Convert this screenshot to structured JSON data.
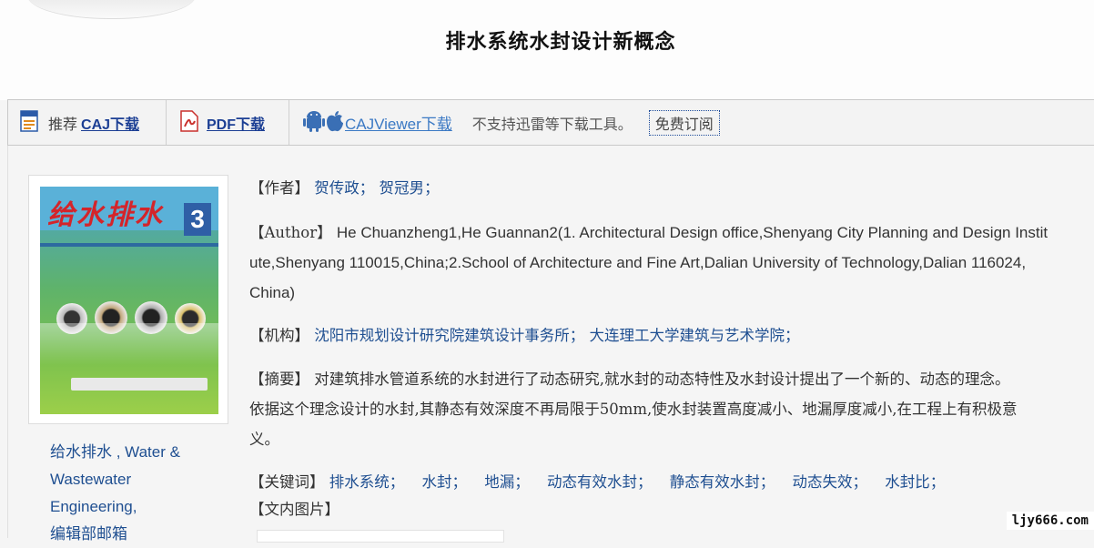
{
  "page": {
    "title": "排水系统水封设计新概念"
  },
  "toolbar": {
    "recommend_label": "推荐",
    "caj_download_label": "CAJ下载",
    "pdf_download_label": "PDF下载",
    "cajviewer_label": "CAJViewer下载",
    "note": "不支持迅雷等下载工具。",
    "subscribe_label": "免费订阅"
  },
  "journal": {
    "cover_title": "给水排水",
    "cover_issue": "3",
    "name_line1": "给水排水 , Water &",
    "name_line2": "Wastewater",
    "name_line3": "Engineering,",
    "name_line4": "编辑部邮箱"
  },
  "meta": {
    "author_label": "【作者】",
    "author_value": "贺传政； 贺冠男；",
    "author_en_label": "【Author】",
    "author_en_line1": "He Chuanzheng1,He Guannan2(1. Architectural Design office,Shenyang City Planning and Design Instit",
    "author_en_line2": "ute,Shenyang 110015,China;2.School of Architecture and Fine Art,Dalian University of Technology,Dalian 116024,",
    "author_en_line3": "China)",
    "org_label": "【机构】",
    "org_value": "沈阳市规划设计研究院建筑设计事务所； 大连理工大学建筑与艺术学院；",
    "abstract_label": "【摘要】",
    "abstract_line1": "对建筑排水管道系统的水封进行了动态研究,就水封的动态特性及水封设计提出了一个新的、动态的理念。",
    "abstract_line2": "依据这个理念设计的水封,其静态有效深度不再局限于50mm,使水封装置高度减小、地漏厚度减小,在工程上有积极意",
    "abstract_line3": "义。",
    "keywords_label": "【关键词】",
    "keywords": [
      "排水系统；",
      "水封；",
      "地漏；",
      "动态有效水封；",
      "静态有效水封；",
      "动态失效；",
      "水封比；"
    ],
    "figures_label": "【文内图片】"
  },
  "watermark": "ljy666.com",
  "colors": {
    "link": "#1c3f94",
    "value": "#1f4f91",
    "background": "#f5f5f5"
  }
}
